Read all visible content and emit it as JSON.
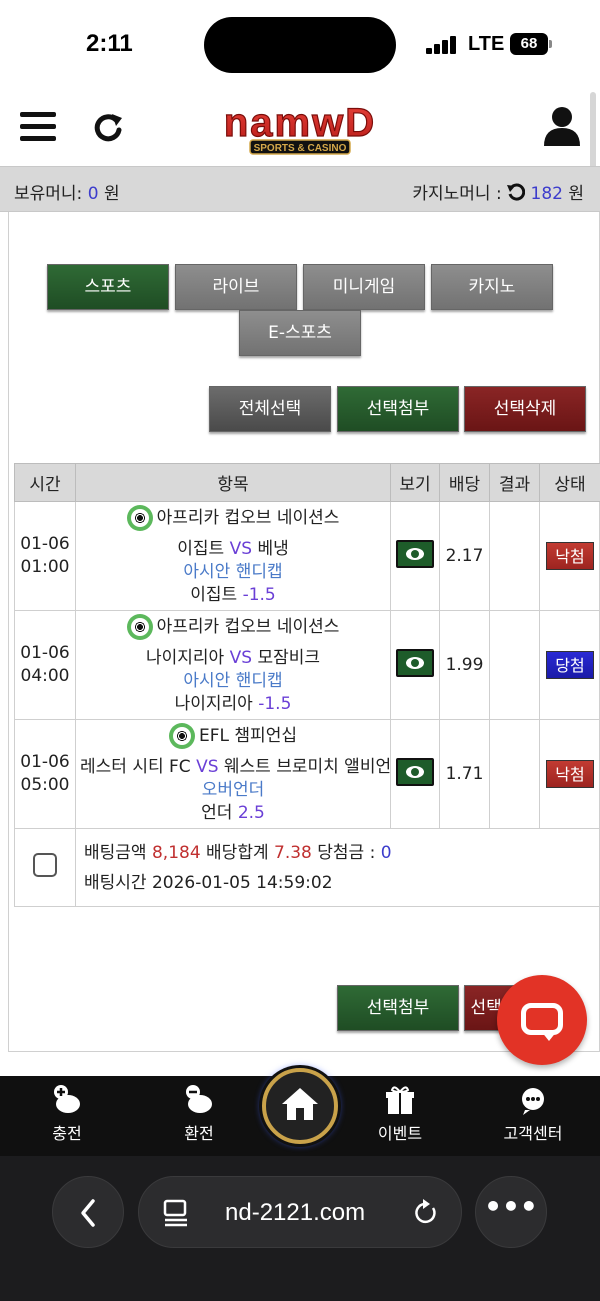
{
  "status_bar": {
    "time": "2:11",
    "network": "LTE",
    "battery": "68"
  },
  "header": {
    "logo_text": "namwD",
    "logo_sub": "SPORTS & CASINO"
  },
  "balance": {
    "label": "보유머니:",
    "amount": "0",
    "unit": "원",
    "casino_label": "카지노머니 :",
    "casino_amount": "182",
    "casino_unit": "원"
  },
  "tabs": [
    "스포츠",
    "라이브",
    "미니게임",
    "카지노",
    "E-스포츠"
  ],
  "actions": {
    "select_all": "전체선택",
    "attach": "선택첨부",
    "delete": "선택삭제"
  },
  "table": {
    "headers": [
      "시간",
      "항목",
      "보기",
      "배당",
      "결과",
      "상태"
    ],
    "rows": [
      {
        "date": "01-06",
        "time": "01:00",
        "league": "아프리카 컵오브 네이션스",
        "home": "이집트",
        "vs": "VS",
        "away": "베냉",
        "market": "아시안 핸디캡",
        "pick": "이집트",
        "line": "-1.5",
        "odds": "2.17",
        "status": "낙첨"
      },
      {
        "date": "01-06",
        "time": "04:00",
        "league": "아프리카 컵오브 네이션스",
        "home": "나이지리아",
        "vs": "VS",
        "away": "모잠비크",
        "market": "아시안 핸디캡",
        "pick": "나이지리아",
        "line": "-1.5",
        "odds": "1.99",
        "status": "당첨"
      },
      {
        "date": "01-06",
        "time": "05:00",
        "league": "EFL 챔피언십",
        "home": "레스터 시티 FC",
        "vs": "VS",
        "away": "웨스트 브로미치 앨비언",
        "market": "오버언더",
        "pick": "언더",
        "line": "2.5",
        "odds": "1.71",
        "status": "낙첨"
      }
    ],
    "summary": {
      "bet_label": "배팅금액",
      "bet_amount": "8,184",
      "odds_label": "배당합계",
      "odds_total": "7.38",
      "win_label": "당첨금 :",
      "win_amount": "0",
      "time_label": "배팅시간",
      "time_value": "2026-01-05 14:59:02"
    }
  },
  "bottom_actions": {
    "attach": "선택첨부",
    "delete": "선택삭제"
  },
  "bottom_nav": {
    "charge": "충전",
    "exchange": "환전",
    "event": "이벤트",
    "support": "고객센터"
  },
  "browser": {
    "url": "nd-2121.com"
  },
  "colors": {
    "green": "#1f4d24",
    "maroon": "#6a1515",
    "odds_red": "#c03030",
    "blue": "#3c3ccc",
    "purple": "#6a3fd6"
  }
}
